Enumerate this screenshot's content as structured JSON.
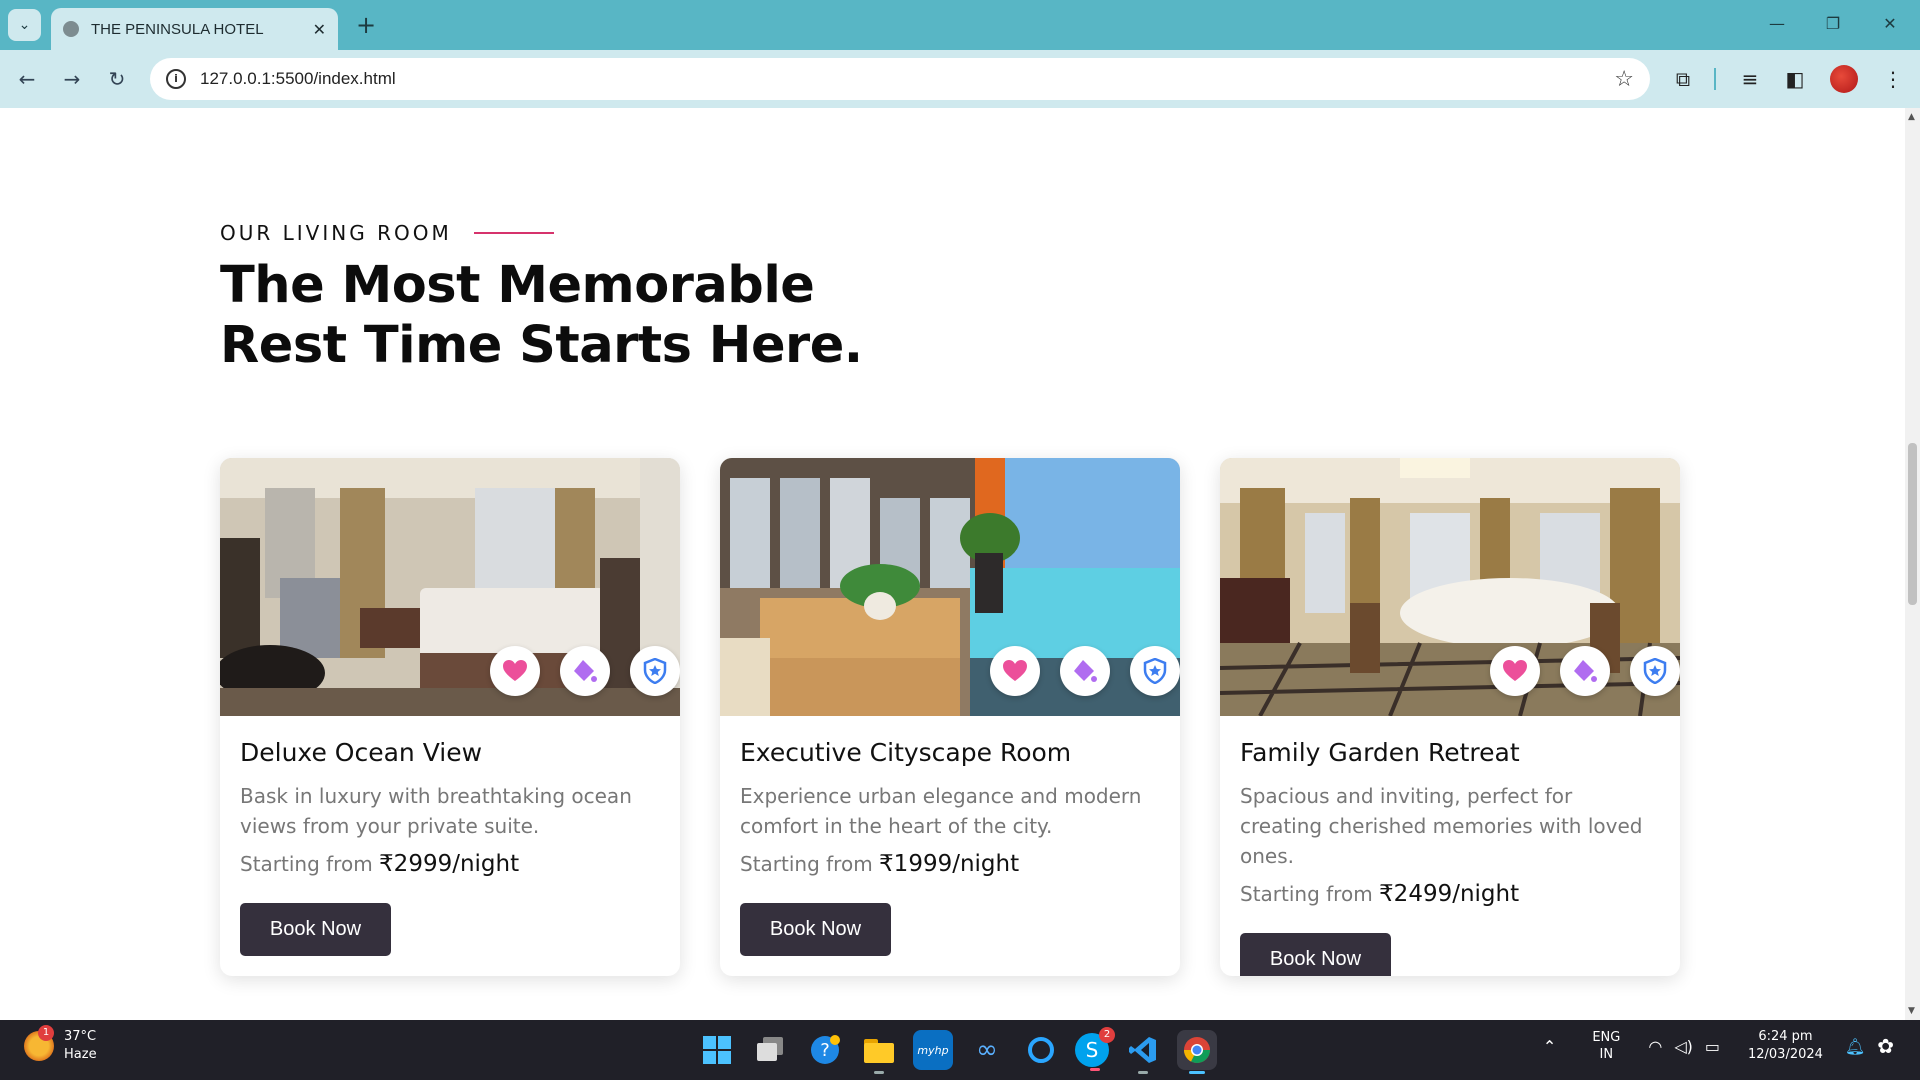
{
  "browser": {
    "tab_title": "THE PENINSULA HOTEL",
    "url": "127.0.0.1:5500/index.html",
    "tab_close": "✕",
    "new_tab": "+",
    "window_min": "—",
    "window_restore": "❐",
    "window_close": "✕"
  },
  "section": {
    "eyebrow": "OUR LIVING ROOM",
    "headline": "The Most Memorable Rest Time Starts Here.",
    "accent_color": "#d6336c"
  },
  "rooms": [
    {
      "name": "Deluxe Ocean View",
      "description": "Bask in luxury with breathtaking ocean views from your private suite.",
      "price_prefix": "Starting from",
      "price": "₹2999/night",
      "button": "Book Now"
    },
    {
      "name": "Executive Cityscape Room",
      "description": "Experience urban elegance and modern comfort in the heart of the city.",
      "price_prefix": "Starting from",
      "price": "₹1999/night",
      "button": "Book Now"
    },
    {
      "name": "Family Garden Retreat",
      "description": "Spacious and inviting, perfect for creating cherished memories with loved ones.",
      "price_prefix": "Starting from",
      "price": "₹2499/night",
      "button": "Book Now"
    }
  ],
  "badge_icons": [
    "heart-icon",
    "paint-bucket-icon",
    "shield-star-icon"
  ],
  "taskbar": {
    "temperature": "37°C",
    "condition": "Haze",
    "weather_badge": "1",
    "lang_top": "ENG",
    "lang_bottom": "IN",
    "time": "6:24 pm",
    "date": "12/03/2024",
    "skype_badge": "2"
  }
}
